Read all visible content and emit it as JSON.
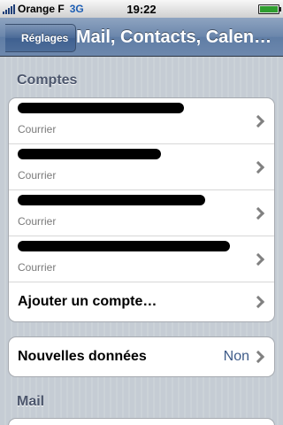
{
  "status": {
    "carrier": "Orange F",
    "network": "3G",
    "time": "19:22"
  },
  "nav": {
    "back_label": "Réglages",
    "title": "Mail, Contacts, Calen…"
  },
  "accounts_section": {
    "header": "Comptes",
    "accounts": [
      {
        "type": "Courrier",
        "name_redacted": true
      },
      {
        "type": "Courrier",
        "name_redacted": true
      },
      {
        "type": "Courrier",
        "name_redacted": true
      },
      {
        "type": "Courrier",
        "name_redacted": true
      }
    ],
    "add_account_label": "Ajouter un compte…"
  },
  "fetch_section": {
    "label": "Nouvelles données",
    "value": "Non"
  },
  "mail_section": {
    "header": "Mail"
  },
  "colors": {
    "nav_bar": "#6d88ad",
    "background": "#c5ccd4",
    "value_blue": "#3d5a88",
    "header_gray": "#4c566c"
  },
  "icons": [
    "signal-bars-icon",
    "battery-icon",
    "chevron-right-icon"
  ]
}
